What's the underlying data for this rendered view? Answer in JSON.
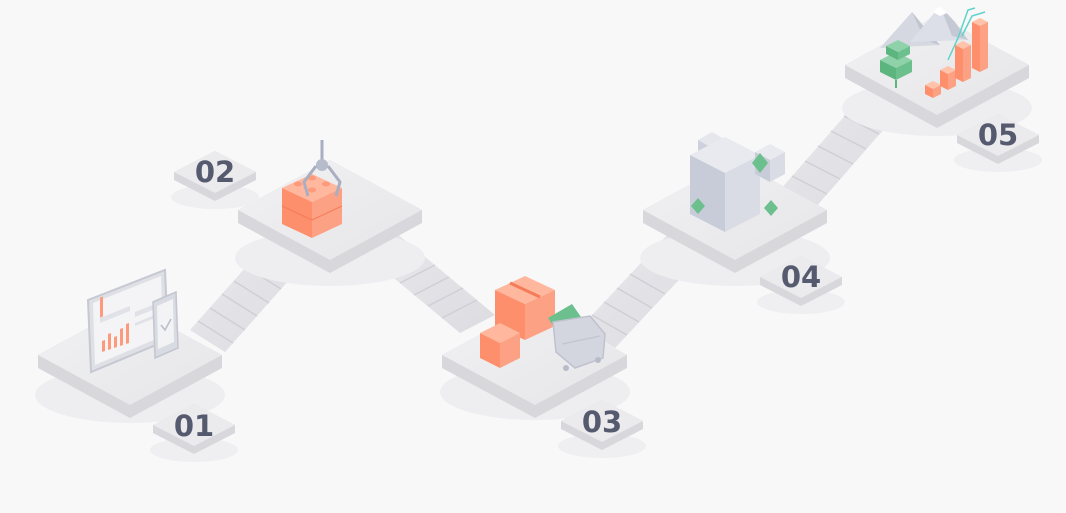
{
  "steps": [
    {
      "label": "01",
      "icon": "dashboard-devices-icon"
    },
    {
      "label": "02",
      "icon": "crane-claw-blocks-icon"
    },
    {
      "label": "03",
      "icon": "boxes-cart-icon"
    },
    {
      "label": "04",
      "icon": "cubes-gems-icon"
    },
    {
      "label": "05",
      "icon": "mountains-growth-chart-icon"
    }
  ],
  "colors": {
    "background": "#f8f8f9",
    "platform_top": "#ececee",
    "platform_side": "#d7d7dc",
    "label_text": "#555a6f",
    "accent_orange": "#fd9a7b",
    "accent_green": "#6cc08d",
    "accent_gray": "#b7bccb"
  }
}
